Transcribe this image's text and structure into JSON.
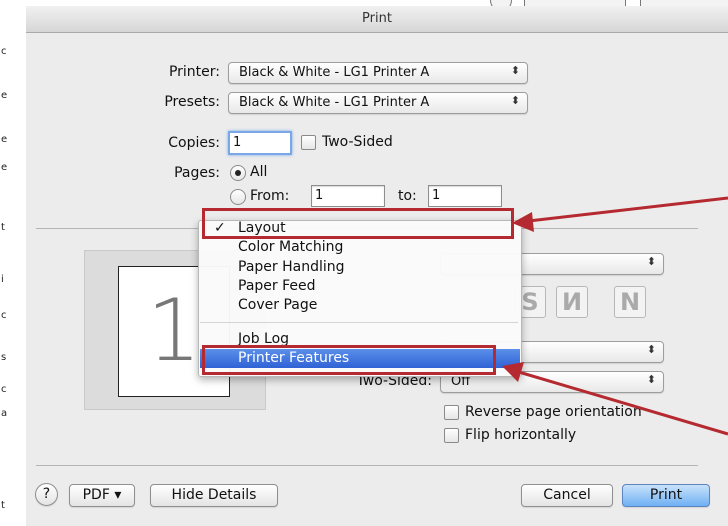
{
  "window": {
    "title": "Print"
  },
  "printer": {
    "label": "Printer:",
    "value": "Black & White - LG1 Printer A"
  },
  "presets": {
    "label": "Presets:",
    "value": "Black & White - LG1 Printer A"
  },
  "copies": {
    "label": "Copies:",
    "value": "1",
    "two_sided_label": "Two-Sided"
  },
  "pages": {
    "label": "Pages:",
    "all_label": "All",
    "from_label": "From:",
    "from_value": "1",
    "to_label": "to:",
    "to_value": "1"
  },
  "preview": {
    "page_number": "1"
  },
  "menu": {
    "items": [
      {
        "label": "Layout",
        "checked": "✓"
      },
      {
        "label": "Color Matching"
      },
      {
        "label": "Paper Handling"
      },
      {
        "label": "Paper Feed"
      },
      {
        "label": "Cover Page"
      },
      {
        "label": "Job Log"
      },
      {
        "label": "Printer Features"
      }
    ]
  },
  "layout_panel": {
    "two_sided_label": "Two-Sided:",
    "two_sided_value": "Off",
    "reverse_label": "Reverse page orientation",
    "flip_label": "Flip horizontally"
  },
  "footer": {
    "help_label": "?",
    "pdf_label": "PDF ▾",
    "hide_details_label": "Hide Details",
    "cancel_label": "Cancel",
    "print_label": "Print"
  },
  "colors": {
    "highlight": "#3a6fdc",
    "annotation": "#b52a30",
    "print_button": "#6fb0f3"
  }
}
